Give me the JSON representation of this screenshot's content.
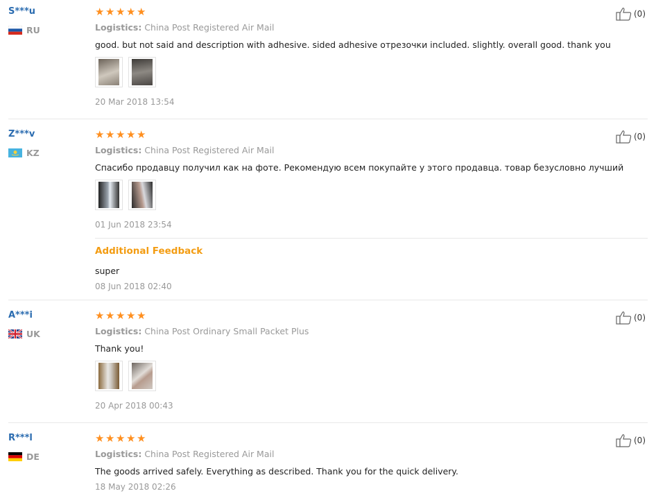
{
  "reviews": [
    {
      "user": "S***u",
      "country": "RU",
      "stars": 5,
      "logistics_label": "Logistics:",
      "logistics": "China Post Registered Air Mail",
      "text": "good. but not said and description with adhesive. sided adhesive отрезочки included. slightly. overall good. thank you",
      "date": "20 Mar 2018 13:54",
      "likes": "(0)"
    },
    {
      "user": "Z***v",
      "country": "KZ",
      "stars": 5,
      "logistics_label": "Logistics:",
      "logistics": "China Post Registered Air Mail",
      "text": "Спасибо продавцу получил как на фоте. Рекомендую всем покупайте у этого продавца. товар безусловно лучший",
      "date": "01 Jun 2018 23:54",
      "likes": "(0)",
      "additional": {
        "title": "Additional Feedback",
        "text": "super",
        "date": "08 Jun 2018 02:40"
      }
    },
    {
      "user": "A***i",
      "country": "UK",
      "stars": 5,
      "logistics_label": "Logistics:",
      "logistics": "China Post Ordinary Small Packet Plus",
      "text": "Thank you!",
      "date": "20 Apr 2018 00:43",
      "likes": "(0)"
    },
    {
      "user": "R***l",
      "country": "DE",
      "stars": 5,
      "logistics_label": "Logistics:",
      "logistics": "China Post Registered Air Mail",
      "text": "The goods arrived safely. Everything as described. Thank you for the quick delivery.",
      "date": "18 May 2018 02:26",
      "likes": "(0)"
    }
  ],
  "colors": {
    "star": "#ff8f1f",
    "username": "#2b6cb0",
    "additional_title": "#f39c12"
  }
}
